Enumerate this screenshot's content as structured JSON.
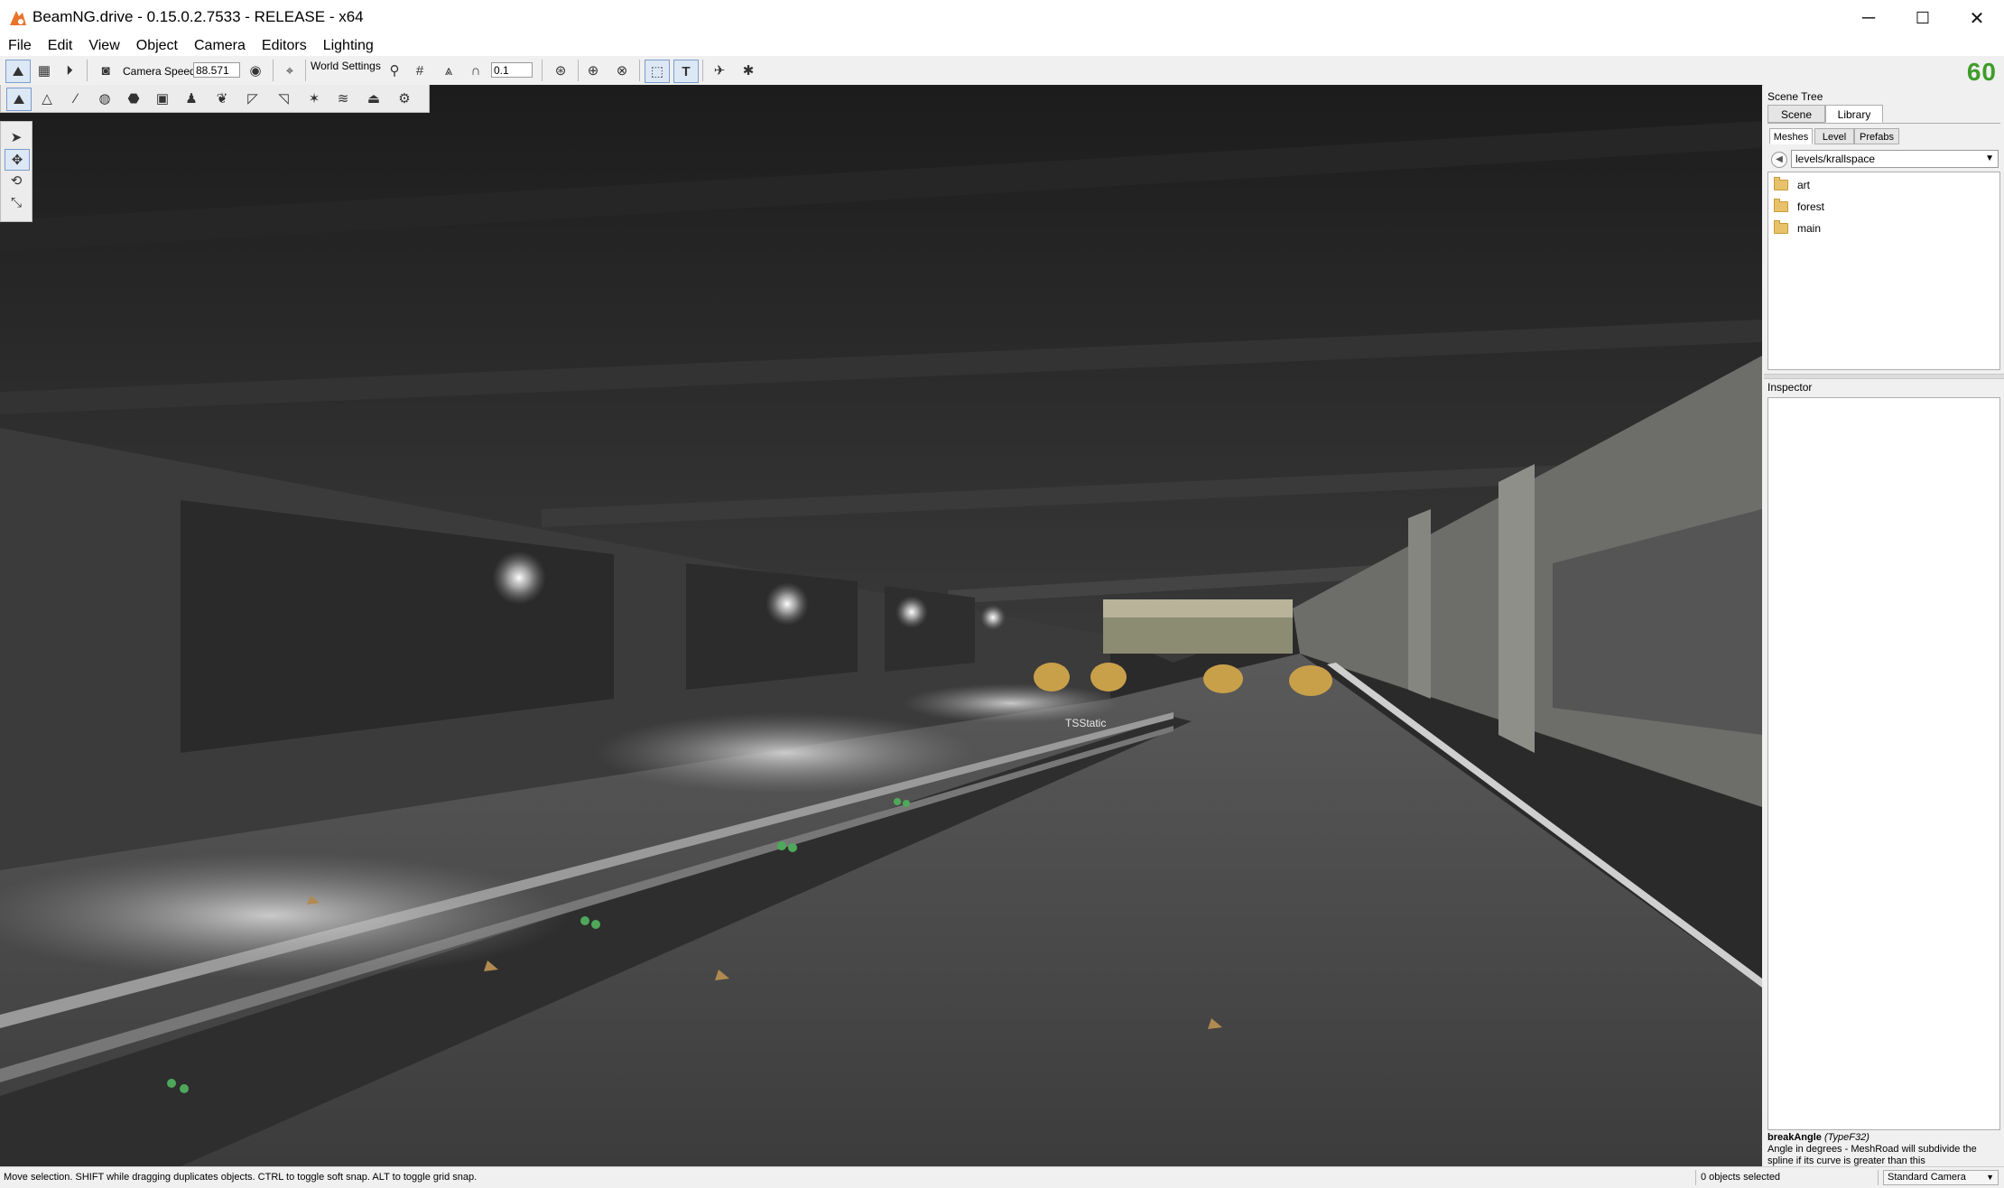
{
  "window": {
    "title": "BeamNG.drive - 0.15.0.2.7533 - RELEASE - x64",
    "minimize": "─",
    "maximize": "☐",
    "close": "✕"
  },
  "menu": [
    "File",
    "Edit",
    "View",
    "Object",
    "Camera",
    "Editors",
    "Lighting"
  ],
  "toolbar": {
    "camera_speed_label": "Camera Speed",
    "camera_speed_value": "88.571",
    "world_settings_label": "World Settings",
    "snap_value": "0.1",
    "fps": "60"
  },
  "viewport": {
    "object_label": "TSStatic"
  },
  "scene_tree": {
    "header": "Scene Tree",
    "tabs": [
      "Scene",
      "Library"
    ],
    "active_tab": "Library",
    "subtabs": [
      "Meshes",
      "Level",
      "Prefabs"
    ],
    "active_subtab": "Meshes",
    "path": "levels/krallspace",
    "folders": [
      "art",
      "forest",
      "main"
    ]
  },
  "inspector": {
    "header": "Inspector",
    "help_title": "breakAngle",
    "help_type": "(TypeF32)",
    "help_text": "Angle in degrees - MeshRoad will subdivide the spline if its curve is greater than this"
  },
  "status": {
    "message": "Move selection.  SHIFT while dragging duplicates objects.  CTRL to toggle soft snap.  ALT to toggle grid snap.",
    "selection": "0 objects selected",
    "camera": "Standard Camera"
  },
  "colors": {
    "fps": "#3f9c2b",
    "app_icon": "#e8742a"
  },
  "icons": {
    "app": "beamng-logo-icon",
    "dropdown": "chevron-down-icon",
    "folder": "folder-icon"
  }
}
